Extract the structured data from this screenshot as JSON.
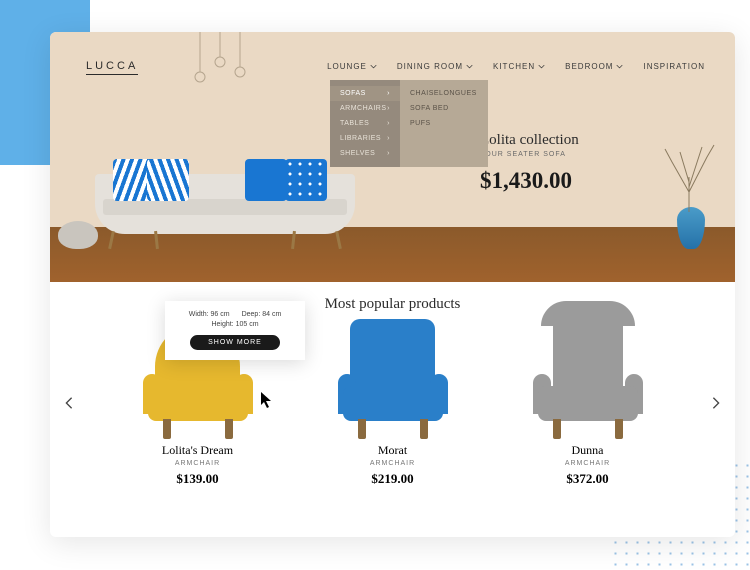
{
  "logo": "LUCCA",
  "nav": {
    "lounge": "LOUNGE",
    "dining": "DINING ROOM",
    "kitchen": "KITCHEN",
    "bedroom": "BEDROOM",
    "inspiration": "INSPIRATION"
  },
  "dropdown": {
    "col1": {
      "sofas": "SOFAS",
      "armchairs": "ARMCHAIRS",
      "tables": "TABLES",
      "libraries": "LIBRARIES",
      "shelves": "SHELVES"
    },
    "col2": {
      "chaise": "CHAISELONGUES",
      "sofabed": "SOFA BED",
      "pufs": "PUFS"
    }
  },
  "hero": {
    "title": "Lolita collection",
    "subtitle": "FOUR SEATER SOFA",
    "price": "$1,430.00"
  },
  "popular": {
    "title": "Most popular products"
  },
  "tooltip": {
    "width_label": "Width:",
    "width_val": "96 cm",
    "deep_label": "Deep:",
    "deep_val": "84 cm",
    "height_label": "Height:",
    "height_val": "105 cm",
    "button": "SHOW MORE"
  },
  "products": [
    {
      "name": "Lolita's Dream",
      "type": "ARMCHAIR",
      "price": "$139.00"
    },
    {
      "name": "Morat",
      "type": "ARMCHAIR",
      "price": "$219.00"
    },
    {
      "name": "Dunna",
      "type": "ARMCHAIR",
      "price": "$372.00"
    }
  ]
}
